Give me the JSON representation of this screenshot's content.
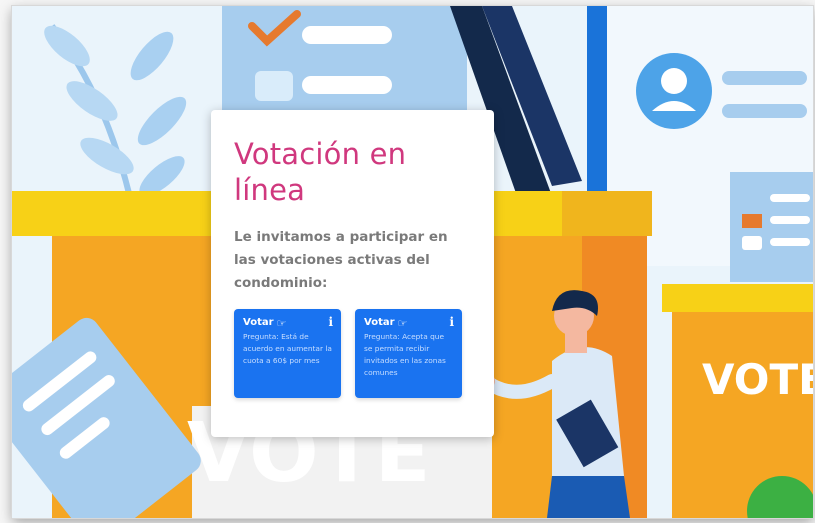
{
  "card": {
    "title": "Votación en línea",
    "subtitle": "Le invitamos a participar en las votaciones activas del condominio:"
  },
  "vote_cards": [
    {
      "label": "Votar",
      "hand_icon": "pointing-hand-icon",
      "info_icon": "info-icon",
      "question": "Pregunta: Está de acuerdo en aumentar la cuota a 60$ por mes"
    },
    {
      "label": "Votar",
      "hand_icon": "pointing-hand-icon",
      "info_icon": "info-icon",
      "question": "Pregunta: Acepta que se permita recibir invitados en las zonas comunes"
    }
  ],
  "illustration": {
    "ballot_box_left_text": "VOTE",
    "ballot_box_right_text": "VOTE"
  },
  "colors": {
    "title": "#d0387e",
    "subtitle": "#7a7a7a",
    "vote_card_bg": "#1a73f0",
    "ballot_box": "#f5a623",
    "ballot_top": "#f7d117"
  }
}
